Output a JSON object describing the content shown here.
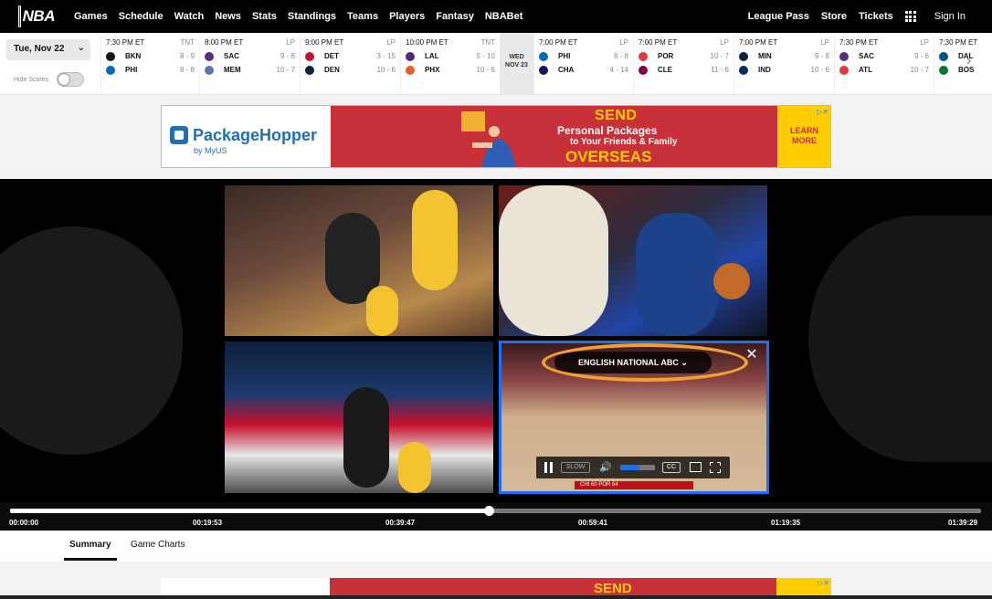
{
  "nav": {
    "logo_text": "NBA",
    "links": [
      "Games",
      "Schedule",
      "Watch",
      "News",
      "Stats",
      "Standings",
      "Teams",
      "Players",
      "Fantasy",
      "NBABet"
    ],
    "right": {
      "league_pass": "League Pass",
      "store": "Store",
      "tickets": "Tickets",
      "sign_in": "Sign In"
    }
  },
  "scoreboard": {
    "date": "Tue, Nov 22",
    "hide_scores": "Hide Scores",
    "divider": {
      "day": "WED",
      "date": "NOV 23"
    },
    "games": [
      {
        "time": "7:30 PM ET",
        "network": "TNT",
        "away": {
          "abbr": "BKN",
          "record": "8 - 9",
          "color": "#111111"
        },
        "home": {
          "abbr": "PHI",
          "record": "8 - 8",
          "color": "#006bb6"
        }
      },
      {
        "time": "8:00 PM ET",
        "network": "LP",
        "away": {
          "abbr": "SAC",
          "record": "9 - 6",
          "color": "#5a2d81"
        },
        "home": {
          "abbr": "MEM",
          "record": "10 - 7",
          "color": "#5d76a9"
        }
      },
      {
        "time": "9:00 PM ET",
        "network": "LP",
        "away": {
          "abbr": "DET",
          "record": "3 - 15",
          "color": "#c8102e"
        },
        "home": {
          "abbr": "DEN",
          "record": "10 - 6",
          "color": "#0e2240"
        }
      },
      {
        "time": "10:00 PM ET",
        "network": "TNT",
        "away": {
          "abbr": "LAL",
          "record": "5 - 10",
          "color": "#552583"
        },
        "home": {
          "abbr": "PHX",
          "record": "10 - 6",
          "color": "#e56020"
        }
      },
      {
        "time": "7:00 PM ET",
        "network": "LP",
        "away": {
          "abbr": "PHI",
          "record": "8 - 8",
          "color": "#006bb6"
        },
        "home": {
          "abbr": "CHA",
          "record": "4 - 14",
          "color": "#1d1160"
        }
      },
      {
        "time": "7:00 PM ET",
        "network": "LP",
        "away": {
          "abbr": "POR",
          "record": "10 - 7",
          "color": "#e03a3e"
        },
        "home": {
          "abbr": "CLE",
          "record": "11 - 6",
          "color": "#860038"
        }
      },
      {
        "time": "7:00 PM ET",
        "network": "LP",
        "away": {
          "abbr": "MIN",
          "record": "9 - 8",
          "color": "#0c2340"
        },
        "home": {
          "abbr": "IND",
          "record": "10 - 6",
          "color": "#002d62"
        }
      },
      {
        "time": "7:30 PM ET",
        "network": "LP",
        "away": {
          "abbr": "SAC",
          "record": "9 - 6",
          "color": "#5a2d81"
        },
        "home": {
          "abbr": "ATL",
          "record": "10 - 7",
          "color": "#e03a3e"
        }
      },
      {
        "time": "7:30 PM ET",
        "network": "",
        "away": {
          "abbr": "DAL",
          "record": "",
          "color": "#00538c"
        },
        "home": {
          "abbr": "BOS",
          "record": "",
          "color": "#007a33"
        }
      }
    ]
  },
  "ad": {
    "brand": "PackageHopper",
    "brand_sub": "by MyUS",
    "line1": "SEND",
    "line2": "Personal Packages",
    "line3": "to Your Friends & Family",
    "line4": "OVERSEAS",
    "cta_line1": "LEARN",
    "cta_line2": "MORE",
    "adchoices": "▷✕"
  },
  "player": {
    "feed": "ENGLISH NATIONAL ABC",
    "speed": "SLOW",
    "cc": "CC",
    "volume_fraction": 0.55,
    "progress_fraction": 0.493,
    "scorebug": "CHI 60 POR 64"
  },
  "timeline": {
    "labels": [
      "00:00:00",
      "00:19:53",
      "00:39:47",
      "00:59:41",
      "01:19:35",
      "01:39:29"
    ]
  },
  "tabs": [
    "Summary",
    "Game Charts"
  ],
  "colors": {
    "accent_blue": "#1d6ff2",
    "feed_ring": "#f0a030",
    "ad_red": "#c8303a",
    "ad_yellow": "#ffcd00"
  }
}
